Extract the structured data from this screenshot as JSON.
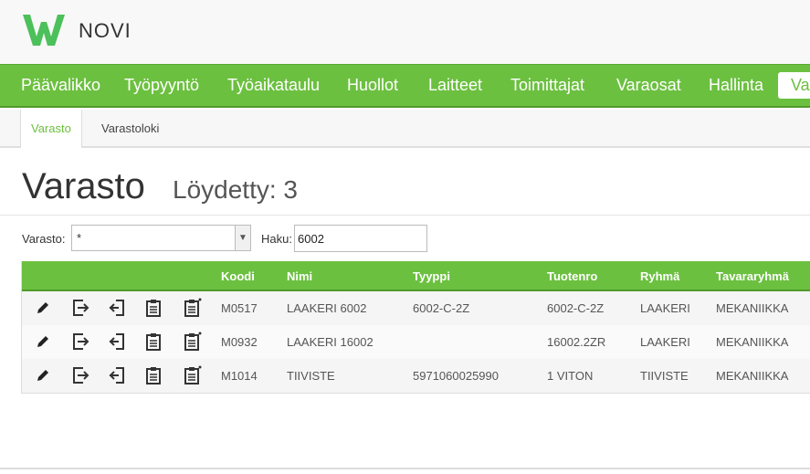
{
  "app": {
    "logo_text": "NOVI",
    "accent": "#6cc040"
  },
  "nav": {
    "items": [
      {
        "label": "Päävalikko"
      },
      {
        "label": "Työpyyntö"
      },
      {
        "label": "Työaikataulu"
      },
      {
        "label": "Huollot"
      },
      {
        "label": "Laitteet"
      },
      {
        "label": "Toimittajat"
      },
      {
        "label": "Varaosat"
      },
      {
        "label": "Hallinta"
      },
      {
        "label": "Va"
      }
    ]
  },
  "subtabs": [
    {
      "label": "Varasto"
    },
    {
      "label": "Varastoloki"
    }
  ],
  "page": {
    "title": "Varasto",
    "count": "Löydetty: 3"
  },
  "filters": {
    "warehouse_label": "Varasto:",
    "warehouse_value": "*",
    "search_label": "Haku:",
    "search_value": "6002"
  },
  "table": {
    "columns": [
      "Koodi",
      "Nimi",
      "Tyyppi",
      "Tuotenro",
      "Ryhmä",
      "Tavararyhmä"
    ],
    "rows": [
      [
        "M0517",
        "LAAKERI 6002",
        "6002-C-2Z",
        "6002-C-2Z",
        "LAAKERI",
        "MEKANIIKKA"
      ],
      [
        "M0932",
        "LAAKERI 16002",
        "",
        "16002.2ZR",
        "LAAKERI",
        "MEKANIIKKA"
      ],
      [
        "M1014",
        "TIIVISTE",
        "5971060025990",
        "1 VITON",
        "TIIVISTE",
        "MEKANIIKKA"
      ]
    ],
    "row_icons": [
      "pencil-icon",
      "export-icon",
      "import-icon",
      "clipboard-icon",
      "clipboard-star-icon"
    ]
  }
}
